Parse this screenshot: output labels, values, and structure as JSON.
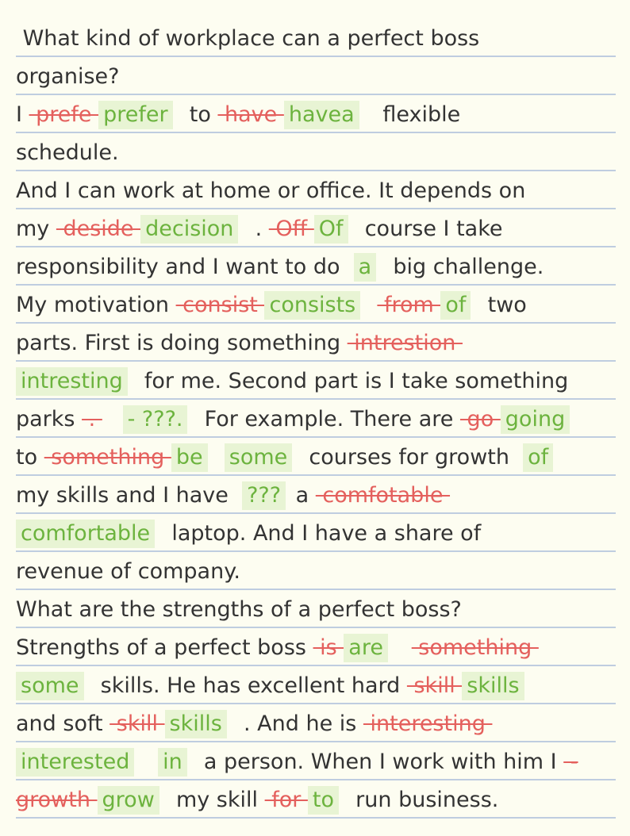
{
  "lines": [
    [
      {
        "t": "n",
        "x": " What kind of workplace can a perfect boss"
      }
    ],
    [
      {
        "t": "n",
        "x": "organise?"
      }
    ],
    [
      {
        "t": "n",
        "x": "I "
      },
      {
        "t": "d",
        "x": " prefe "
      },
      {
        "t": "i",
        "x": "prefer"
      },
      {
        "t": "n",
        "x": "  to "
      },
      {
        "t": "d",
        "x": " have "
      },
      {
        "t": "i",
        "x": "havea"
      },
      {
        "t": "n",
        "x": "   flexible"
      }
    ],
    [
      {
        "t": "n",
        "x": "schedule."
      }
    ],
    [
      {
        "t": "n",
        "x": "And I can work at home or office. It depends on"
      }
    ],
    [
      {
        "t": "n",
        "x": "my "
      },
      {
        "t": "d",
        "x": " deside "
      },
      {
        "t": "i",
        "x": "decision"
      },
      {
        "t": "n",
        "x": "  . "
      },
      {
        "t": "d",
        "x": " Off "
      },
      {
        "t": "i",
        "x": "Of"
      },
      {
        "t": "n",
        "x": "  course I take"
      }
    ],
    [
      {
        "t": "n",
        "x": "responsibility and I want to do  "
      },
      {
        "t": "i",
        "x": "a"
      },
      {
        "t": "n",
        "x": "  big challenge."
      }
    ],
    [
      {
        "t": "n",
        "x": "My motivation "
      },
      {
        "t": "d",
        "x": " consist "
      },
      {
        "t": "i",
        "x": "consists"
      },
      {
        "t": "n",
        "x": "  "
      },
      {
        "t": "d",
        "x": " from "
      },
      {
        "t": "i",
        "x": "of"
      },
      {
        "t": "n",
        "x": "  two"
      }
    ],
    [
      {
        "t": "n",
        "x": "parts. First is doing something "
      },
      {
        "t": "d",
        "x": " intrestion "
      }
    ],
    [
      {
        "t": "i",
        "x": "intresting"
      },
      {
        "t": "n",
        "x": "  for me. Second part is I take something"
      }
    ],
    [
      {
        "t": "n",
        "x": "parks "
      },
      {
        "t": "d",
        "x": " . "
      },
      {
        "t": "n",
        "x": "   "
      },
      {
        "t": "i",
        "x": "- ???."
      },
      {
        "t": "n",
        "x": "  For example. There are "
      },
      {
        "t": "d",
        "x": " go "
      },
      {
        "t": "i",
        "x": "going"
      }
    ],
    [
      {
        "t": "n",
        "x": "to "
      },
      {
        "t": "d",
        "x": " something "
      },
      {
        "t": "i",
        "x": "be"
      },
      {
        "t": "n",
        "x": "  "
      },
      {
        "t": "i",
        "x": "some"
      },
      {
        "t": "n",
        "x": "  courses for growth  "
      },
      {
        "t": "i",
        "x": "of"
      }
    ],
    [
      {
        "t": "n",
        "x": "my skills and I have  "
      },
      {
        "t": "i",
        "x": "???"
      },
      {
        "t": "n",
        "x": " a "
      },
      {
        "t": "d",
        "x": " comfotable "
      }
    ],
    [
      {
        "t": "i",
        "x": "comfortable"
      },
      {
        "t": "n",
        "x": "  laptop. And I have a share of"
      }
    ],
    [
      {
        "t": "n",
        "x": "revenue of company."
      }
    ],
    [
      {
        "t": "n",
        "x": "What are the strengths of a perfect boss?"
      }
    ],
    [
      {
        "t": "n",
        "x": "Strengths of a perfect boss "
      },
      {
        "t": "d",
        "x": " is "
      },
      {
        "t": "i",
        "x": "are"
      },
      {
        "t": "n",
        "x": "   "
      },
      {
        "t": "d",
        "x": " something "
      }
    ],
    [
      {
        "t": "i",
        "x": "some"
      },
      {
        "t": "n",
        "x": "  skills. He has excellent hard "
      },
      {
        "t": "d",
        "x": " skill "
      },
      {
        "t": "i",
        "x": "skills"
      }
    ],
    [
      {
        "t": "n",
        "x": "and soft "
      },
      {
        "t": "d",
        "x": " skill "
      },
      {
        "t": "i",
        "x": "skills"
      },
      {
        "t": "n",
        "x": "  . And he is "
      },
      {
        "t": "d",
        "x": " interesting "
      }
    ],
    [
      {
        "t": "i",
        "x": "interested"
      },
      {
        "t": "n",
        "x": "   "
      },
      {
        "t": "i",
        "x": "in"
      },
      {
        "t": "n",
        "x": "  a person. When I work with him I "
      },
      {
        "t": "d",
        "x": " -"
      }
    ],
    [
      {
        "t": "d",
        "x": "growth "
      },
      {
        "t": "i",
        "x": "grow"
      },
      {
        "t": "n",
        "x": "  my skill "
      },
      {
        "t": "d",
        "x": " for "
      },
      {
        "t": "i",
        "x": "to"
      },
      {
        "t": "n",
        "x": "  run business."
      }
    ]
  ]
}
